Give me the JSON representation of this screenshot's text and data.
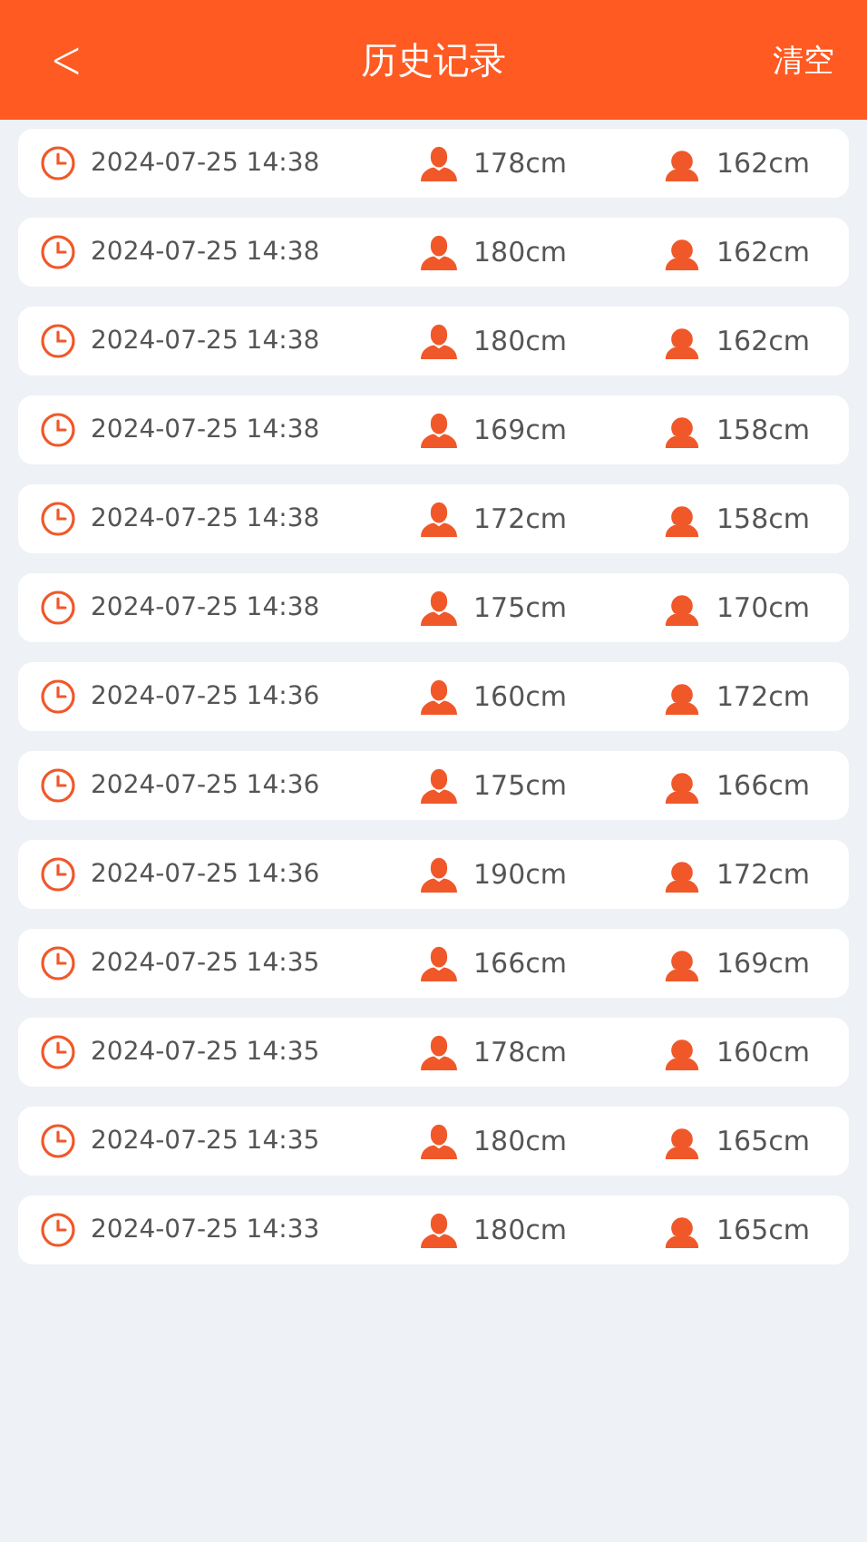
{
  "header": {
    "back": "<",
    "title": "历史记录",
    "action": "清空"
  },
  "records": [
    {
      "time": "2024-07-25 14:38",
      "male": "178cm",
      "female": "162cm"
    },
    {
      "time": "2024-07-25 14:38",
      "male": "180cm",
      "female": "162cm"
    },
    {
      "time": "2024-07-25 14:38",
      "male": "180cm",
      "female": "162cm"
    },
    {
      "time": "2024-07-25 14:38",
      "male": "169cm",
      "female": "158cm"
    },
    {
      "time": "2024-07-25 14:38",
      "male": "172cm",
      "female": "158cm"
    },
    {
      "time": "2024-07-25 14:38",
      "male": "175cm",
      "female": "170cm"
    },
    {
      "time": "2024-07-25 14:36",
      "male": "160cm",
      "female": "172cm"
    },
    {
      "time": "2024-07-25 14:36",
      "male": "175cm",
      "female": "166cm"
    },
    {
      "time": "2024-07-25 14:36",
      "male": "190cm",
      "female": "172cm"
    },
    {
      "time": "2024-07-25 14:35",
      "male": "166cm",
      "female": "169cm"
    },
    {
      "time": "2024-07-25 14:35",
      "male": "178cm",
      "female": "160cm"
    },
    {
      "time": "2024-07-25 14:35",
      "male": "180cm",
      "female": "165cm"
    },
    {
      "time": "2024-07-25 14:33",
      "male": "180cm",
      "female": "165cm"
    }
  ]
}
